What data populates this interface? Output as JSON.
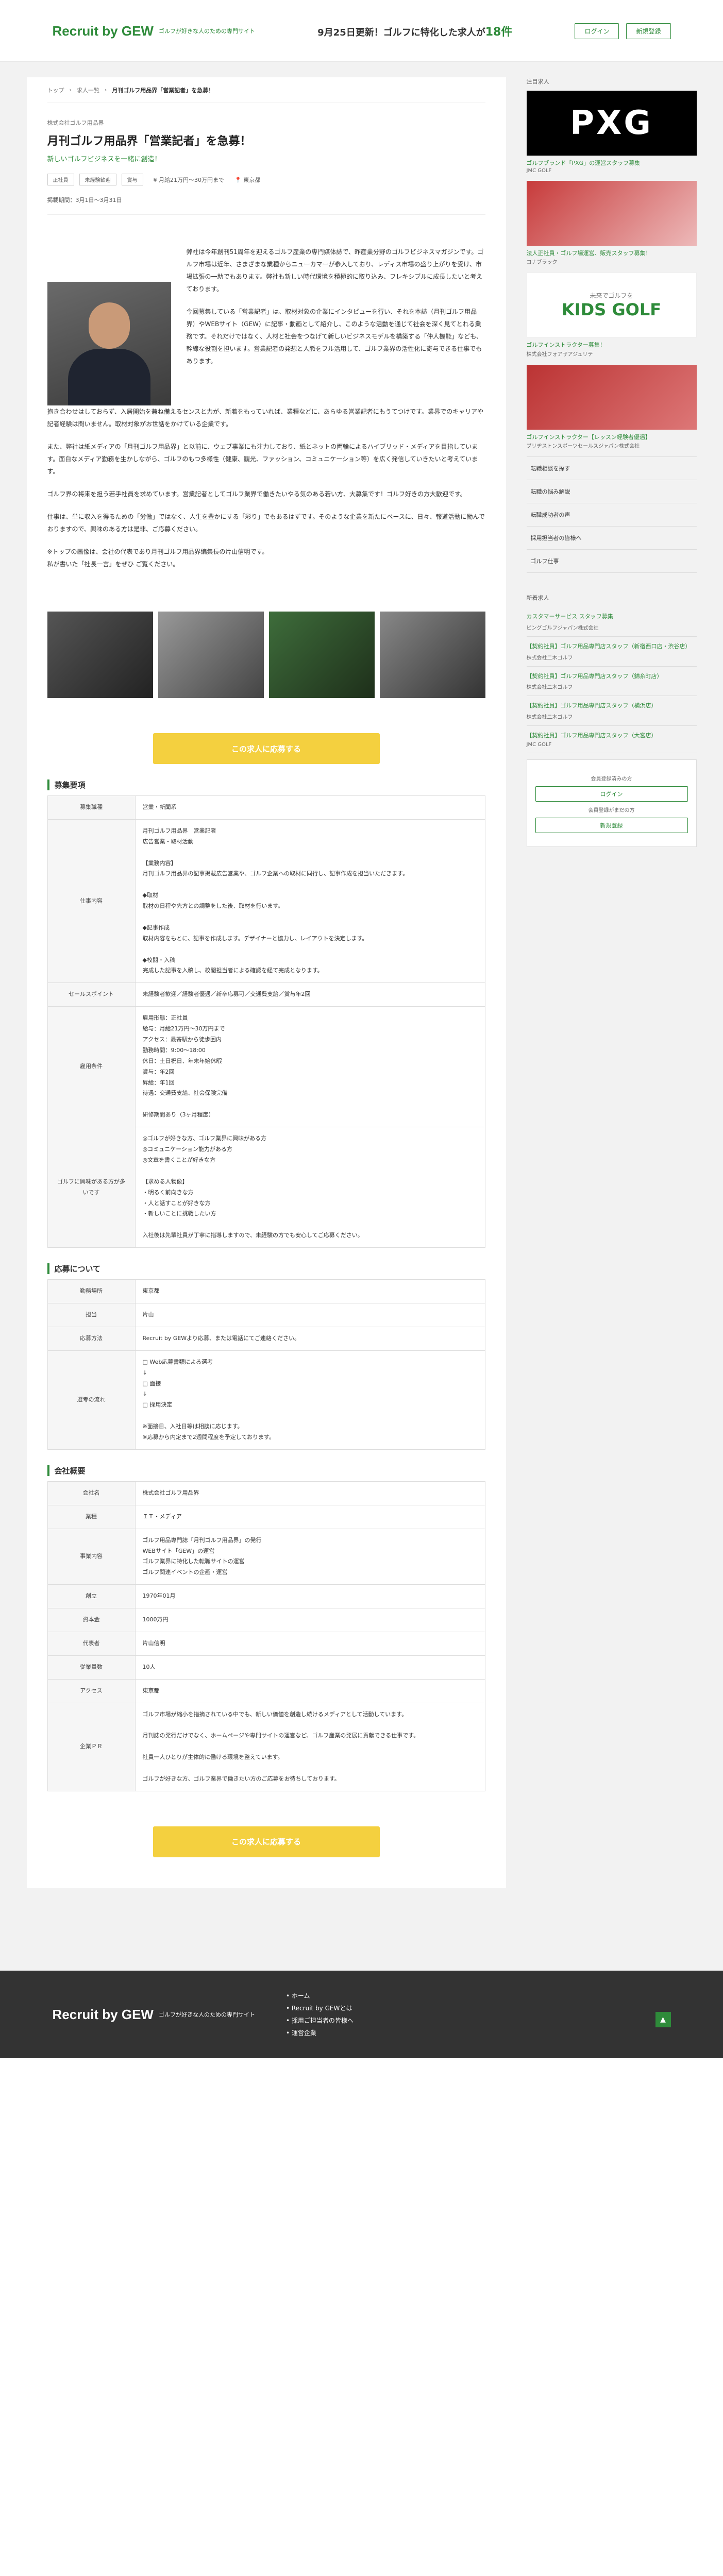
{
  "header": {
    "logo_text": "Recruit by GEW",
    "logo_tag": "ゴルフが好きな人のための専門サイト",
    "center": "9月25日更新！ゴルフに特化した求人が",
    "count": "18件",
    "login": "ログイン",
    "register": "新規登録"
  },
  "breadcrumb": [
    "トップ",
    "求人一覧",
    "月刊ゴルフ用品界「営業記者」を急募！"
  ],
  "job": {
    "company": "株式会社ゴルフ用品界",
    "title": "月刊ゴルフ用品界「営業記者」を急募！",
    "subtitle": "新しいゴルフビジネスを一緒に創造！",
    "tags": [
      "正社員",
      "未経験歓迎",
      "賞与"
    ],
    "salary": "月給21万円〜30万円まで",
    "location": "東京都",
    "period": "掲載期間：3月1日〜3月31日"
  },
  "intro_paragraphs": [
    "弊社は今年創刊51周年を迎えるゴルフ産業の専門媒体誌で、昨産業分野のゴルフビジネスマガジンです。ゴルフ市場は近年、さまざまな業種からニューカマーが参入しており、レディス市場の盛り上がりを受け、市場拡張の一助でもあります。弊社も新しい時代環境を積極的に取り込み、フレキシブルに成長したいと考えております。",
    "今回募集している「営業記者」は、取材対象の企業にインタビューを行い、それを本誌（月刊ゴルフ用品界）やWEBサイト（GEW）に記事・動画として紹介し、このような活動を通じて社会を深く見てとれる業務です。それだけではなく、人材と社会をつなげて新しいビジネスモデルを構築する「仲人機能」なども、幹線な役割を担います。営業記者の発想と人脈をフル活用して、ゴルフ業界の活性化に寄与できる仕事でもあります。"
  ],
  "body_paragraphs": [
    "抱き合わせはしておらず、入居開始を兼ね備えるセンスと力が、新着をもっていれば、業種などに、あらゆる営業記者にもうてつけです。業界でのキャリアや記者経験は問いません。取材対象がお世話をかけている企業です。",
    "また、弊社は紙メディアの「月刊ゴルフ用品界」と以前に、ウェブ事業にも注力しており、紙とネットの両輪によるハイブリッド・メディアを目指しています。面白なメディア勤務を生かしながら、ゴルフのもつ多様性（健康、観光、ファッション、コミュニケーション等）を広く発信していきたいと考えています。",
    "ゴルフ界の将来を担う若手社員を求めています。営業記者としてゴルフ業界で働きたいやる気のある若い方、大募集です！ゴルフ好きの方大歓迎です。",
    "仕事は、単に収入を得るための「労働」ではなく、人生を豊かにする「彩り」でもあるはずです。そのような企業を新たにベースに、日々、報道活動に励んでおりますので、興味のある方は是非、ご応募ください。",
    "※トップの画像は、会社の代表であり月刊ゴルフ用品界編集長の片山信明です。\n私が書いた「社長一言」をぜひ ご覧ください。"
  ],
  "apply_label": "この求人に応募する",
  "section_titles": {
    "requirements": "募集要項",
    "application": "応募について",
    "company": "会社概要"
  },
  "requirements": [
    {
      "label": "募集職種",
      "value": "営業・新聞系"
    },
    {
      "label": "仕事内容",
      "value": "月刊ゴルフ用品界　営業記者\n広告営業・取材活動\n\n【業務内容】\n月刊ゴルフ用品界の記事掲載広告営業や、ゴルフ企業への取材に同行し、記事作成を担当いただきます。\n\n◆取材\n取材の日程や先方との調整をした後、取材を行います。\n\n◆記事作成\n取材内容をもとに、記事を作成します。デザイナーと協力し、レイアウトを決定します。\n\n◆校閲・入稿\n完成した記事を入稿し、校閲担当者による確認を経て完成となります。"
    },
    {
      "label": "セールスポイント",
      "value": "未経験者歓迎／経験者優遇／新卒応募可／交通費支給／賞与年2回"
    },
    {
      "label": "雇用条件",
      "value": "雇用形態：正社員\n給与：月給21万円〜30万円まで\nアクセス：最寄駅から徒歩圏内\n勤務時間：9:00〜18:00\n休日：土日祝日、年末年始休暇\n賞与：年2回\n昇給：年1回\n待遇：交通費支給、社会保険完備\n\n研修期間あり（3ヶ月程度）"
    },
    {
      "label": "ゴルフに興味がある方が多いです",
      "value": "◎ゴルフが好きな方、ゴルフ業界に興味がある方\n◎コミュニケーション能力がある方\n◎文章を書くことが好きな方\n\n【求める人物像】\n・明るく前向きな方\n・人と話すことが好きな方\n・新しいことに挑戦したい方\n\n入社後は先輩社員が丁寧に指導しますので、未経験の方でも安心してご応募ください。"
    }
  ],
  "application": [
    {
      "label": "勤務場所",
      "value": "東京都"
    },
    {
      "label": "担当",
      "value": "片山"
    },
    {
      "label": "応募方法",
      "value": "Recruit by GEWより応募、または電話にてご連絡ください。"
    },
    {
      "label": "選考の流れ",
      "value": "□ Web応募書類による選考\n↓\n□ 面接\n↓\n□ 採用決定\n\n※面接日、入社日等は相談に応じます。\n※応募から内定まで2週間程度を予定しております。"
    }
  ],
  "company": [
    {
      "label": "会社名",
      "value": "株式会社ゴルフ用品界"
    },
    {
      "label": "業種",
      "value": "ＩＴ・メディア"
    },
    {
      "label": "事業内容",
      "value": "ゴルフ用品専門誌「月刊ゴルフ用品界」の発行\nWEBサイト「GEW」の運営\nゴルフ業界に特化した転職サイトの運営\nゴルフ関連イベントの企画・運営"
    },
    {
      "label": "創立",
      "value": "1970年01月"
    },
    {
      "label": "資本金",
      "value": "1000万円"
    },
    {
      "label": "代表者",
      "value": "片山信明"
    },
    {
      "label": "従業員数",
      "value": "10人"
    },
    {
      "label": "アクセス",
      "value": "東京都"
    },
    {
      "label": "企業ＰＲ",
      "value": "ゴルフ市場が縮小を指摘されている中でも、新しい価値を創造し続けるメディアとして活動しています。\n\n月刊誌の発行だけでなく、ホームページや専門サイトの運営など、ゴルフ産業の発展に貢献できる仕事です。\n\n社員一人ひとりが主体的に働ける環境を整えています。\n\nゴルフが好きな方、ゴルフ業界で働きたい方のご応募をお待ちしております。"
    }
  ],
  "sidebar": {
    "featured_label": "注目求人",
    "ads": [
      {
        "title": "ゴルフブランド「PXG」の運営スタッフ募集",
        "company": "JMC GOLF"
      },
      {
        "title": "法人正社員・ゴルフ場運営、販売スタッフ募集！",
        "company": "コナブラック"
      },
      {
        "title": "ゴルフインストラクター募集！",
        "company": "株式会社フォアザアジュリテ"
      },
      {
        "title": "ゴルフインストラクター【レッスン経験者優遇】",
        "company": "ブリヂストンスポーツセールスジャパン株式会社"
      }
    ],
    "ad_texts": {
      "pxg": "PXG",
      "kids": "KIDS GOLF",
      "kids_small": "未来でゴルフを"
    },
    "links": [
      "転職相談を探す",
      "転職の悩み解説",
      "転職成功者の声",
      "採用担当者の皆様へ",
      "ゴルフ仕事"
    ],
    "new_label": "新着求人",
    "new_jobs": [
      {
        "title": "カスタマーサービス スタッフ募集",
        "company": "ピングゴルフジャパン株式会社"
      },
      {
        "title": "【契約社員】ゴルフ用品専門店スタッフ（新宿西口店・渋谷店）",
        "company": "株式会社二木ゴルフ"
      },
      {
        "title": "【契約社員】ゴルフ用品専門店スタッフ（錦糸町店）",
        "company": "株式会社二木ゴルフ"
      },
      {
        "title": "【契約社員】ゴルフ用品専門店スタッフ（横浜店）",
        "company": "株式会社二木ゴルフ"
      },
      {
        "title": "【契約社員】ゴルフ用品専門店スタッフ（大宮店）",
        "company": "JMC GOLF"
      }
    ],
    "login_label": "会員登録済みの方",
    "login_btn": "ログイン",
    "register_label": "会員登録がまだの方",
    "register_btn": "新規登録"
  },
  "footer": {
    "logo": "Recruit by GEW",
    "tag": "ゴルフが好きな人のための専門サイト",
    "links": [
      "ホーム",
      "Recruit by GEWとは",
      "採用ご担当者の皆様へ",
      "運営企業"
    ],
    "top": "▲"
  }
}
